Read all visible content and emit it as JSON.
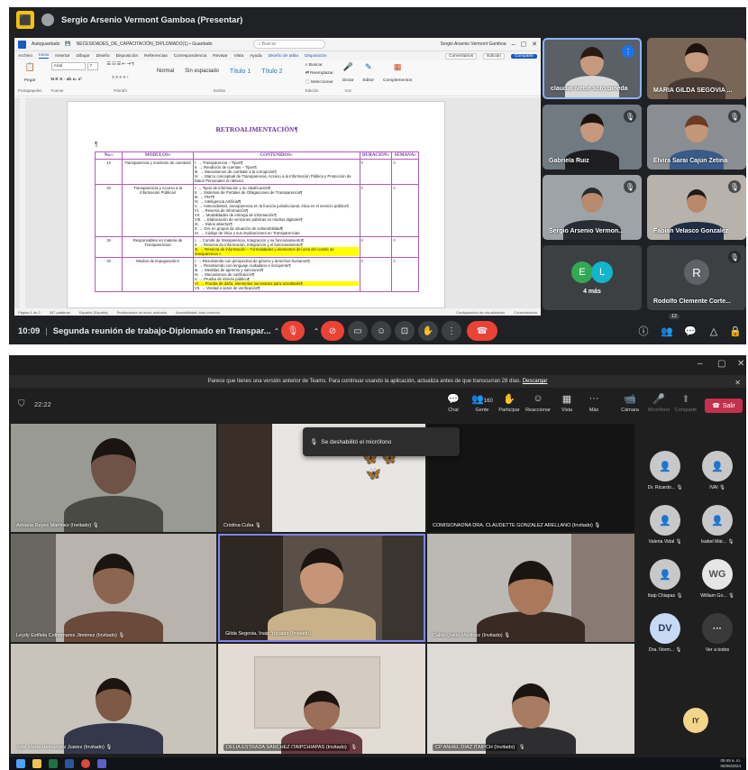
{
  "meet": {
    "presenter_title": "Sergio Arsenio Vermont Gamboa (Presentar)",
    "time": "10:09",
    "separator": "|",
    "meeting_name": "Segunda reunión de trabajo-Diplomado en Transpar...",
    "people_count": "12",
    "participants": [
      {
        "name": "claudia ivette soto pineda"
      },
      {
        "name": "MARIA GILDA SEGOVIA ..."
      },
      {
        "name": "Gabriela Ruiz"
      },
      {
        "name": "Elvira Sarai Cajún Zetina"
      },
      {
        "name": "Sergio Arsenio Vermon..."
      },
      {
        "name": "Fabian Velasco Gonzalez"
      },
      {
        "name": "Rodolfo Clemente Corte..."
      }
    ],
    "more": {
      "label": "4 más",
      "initials": [
        "E",
        "L"
      ]
    },
    "rodolfo_initial": "R",
    "colors": {
      "bg": "#202124",
      "red": "#ea4335",
      "blue": "#1a73e8"
    }
  },
  "word": {
    "autosave": "Autoguardado",
    "filename": "NECESIDADES_DE_CAPACITACIÓN_DIPLOMADO(1) • Guardado",
    "search": "Buscar",
    "user": "Sergio Arsenio Vermont Gamboa",
    "menu": [
      "Archivo",
      "Inicio",
      "Insertar",
      "Dibujar",
      "Diseño",
      "Disposición",
      "Referencias",
      "Correspondencia",
      "Revisar",
      "Vista",
      "Ayuda",
      "Diseño de tabla",
      "Disposición"
    ],
    "menu_right": {
      "comments": "Comentarios",
      "editing": "Edición",
      "share": "Compartir"
    },
    "ribbon": {
      "paste": "Pegar",
      "clipboard": "Portapapeles",
      "font": "Arial",
      "font_size": "7",
      "font_group": "Fuente",
      "paragraph_group": "Párrafo",
      "styles": [
        "Normal",
        "Sin espaciado",
        "Título 1",
        "Título 2"
      ],
      "styles_group": "Estilos",
      "find": "Buscar",
      "replace": "Reemplazar",
      "select": "Seleccionar",
      "edit_group": "Edición",
      "dictate": "Dictar",
      "voice_group": "Voz",
      "editor": "Editor",
      "complements": "Complementos"
    },
    "doc_title": "RETROALIMENTACIÓN¶",
    "table_headers": [
      "No.¤",
      "MÓDULOS¤",
      "CONTENIDOS¤",
      "DURACIÓN¤",
      "SEMANA¤"
    ],
    "rows": [
      {
        "no": "1¤",
        "module": "Transparencia y rendición de cuentas¤",
        "contents": [
          {
            "text": "I. → Transparencia – Tipos¶"
          },
          {
            "text": "II. → Rendición de cuentas – Tipos¶"
          },
          {
            "text": "III. → Mecanismos de combate a la corrupción¶"
          },
          {
            "text": "IV. → Marco conceptual de Transparencia, Acceso a la Información Pública y Protección de Datos Personales en México"
          }
        ]
      },
      {
        "no": "2¤",
        "module": "Transparencia y Acceso a la Información Pública¤",
        "contents": [
          {
            "text": "I. → Tipos de información y su clasificación¶"
          },
          {
            "text": "II. → Sistemas de Portales de Obligaciones de Transparencia¶"
          },
          {
            "text": "III. → PNT¶"
          },
          {
            "text": "IV. → Inteligencia Artificial¶"
          },
          {
            "text": "V. → Antecedentes, transparencia en la función jurisdiccional, ética en el servicio público¶"
          },
          {
            "text": "VI. → Reserva de información¶"
          },
          {
            "text": "VII. → Modalidades de entrega de información¶"
          },
          {
            "text": "VIII. → Elaboración de versiones públicas en medios digitales¶"
          },
          {
            "text": "IX. → Datos abiertos¶"
          },
          {
            "text": "X. → DAI en grupos de situación de vulnerabilidad¶"
          },
          {
            "text": "XI. → Código de ética y sus implicaciones en Transparencian"
          }
        ]
      },
      {
        "no": "3¤",
        "module": "Responsables en materia de Transparencia¤",
        "contents": [
          {
            "text": "I. → Comité de transparencia, Integración y su funcionamiento¶"
          },
          {
            "text": "II. → Reserva de Información, Integración y el funcionamiento¶"
          },
          {
            "text": "III. → Reserva de información – Formalidades y elementos del acta del comité de transparencia »",
            "highlight": true
          }
        ]
      },
      {
        "no": "4¤",
        "module": "Medios de impugnación¤",
        "contents": [
          {
            "text": "I. → Resolviendo con perspectiva de género y derechos humanos¶"
          },
          {
            "text": "II. → Resolviendo con lenguaje ciudadano e incluyente¶"
          },
          {
            "text": "III. → Medidas de apremio y sanciones¶"
          },
          {
            "text": "IV. → Mecanismos de notificación¶"
          },
          {
            "text": "V. → Prueba de interés público¶"
          },
          {
            "text": "VI. → Prueba de daño, elementos necesarios para acreditarla¶",
            "highlight": true
          },
          {
            "text": "VII. → Verdad o actos de verificación¶"
          }
        ]
      }
    ],
    "cell_mark": "¤",
    "pilcrow": "¶",
    "status": [
      "Página 1 de 2",
      "397 palabras",
      "Español (España)",
      "Predicciones de texto: activado",
      "Accesibilidad: todo correcto",
      "Configuración de visualización",
      "Concentración"
    ]
  },
  "teams": {
    "banner": "Parece que tienes una versión anterior de Teams. Para continuar usando la aplicación, actualiza antes de que transcurran 28 días.",
    "banner_link": "Descargar",
    "timer": "22:22",
    "tools": [
      {
        "icon": "💬",
        "label": "Chat"
      },
      {
        "icon": "👥",
        "label": "Gente"
      },
      {
        "icon": "✋",
        "label": "Participar"
      },
      {
        "icon": "☺",
        "label": "Reaccionar"
      },
      {
        "icon": "▦",
        "label": "Vista"
      },
      {
        "icon": "···",
        "label": "Más"
      },
      {
        "icon": "📹",
        "label": "Cámara"
      },
      {
        "icon": "🎤",
        "label": "Micrófono"
      },
      {
        "icon": "⬆",
        "label": "Compartir"
      }
    ],
    "people_count": "160",
    "leave": "Salir",
    "toast": "Se deshabilitó el micrófono",
    "tiles": [
      {
        "name": "Adriana Reyes Martinez (Invitado)"
      },
      {
        "name": "Cristina Cuba"
      },
      {
        "name": "COMISIONADNA DRA. CLAUDETTE GONZALEZ ARELLANO (Invitado)"
      },
      {
        "name": "Leydy Estfiela Colmenares Jiménez (Invitado)"
      },
      {
        "name": "Gilda Segovia, Inaip Yucatán (Invitado)"
      },
      {
        "name": "Dalila Quero Martinez (Invitado)"
      },
      {
        "name": "Jose Maria Hernandez Juarez (Invitado)"
      },
      {
        "name": "DELIA ESTRADA SANCHEZ ITAIPCHIAPAS (Invitado)"
      },
      {
        "name": "CP ANHEL DIAZ ITAIPCH (Invitado)"
      }
    ],
    "side": [
      {
        "name": "Dr. Ricardo...",
        "initials": ""
      },
      {
        "name": "IVAI",
        "initials": ""
      },
      {
        "name": "Valeria Vidal",
        "initials": ""
      },
      {
        "name": "Isabel Már...",
        "initials": ""
      },
      {
        "name": "Itaip Chiapas",
        "initials": ""
      },
      {
        "name": "William Go...",
        "initials": "WG"
      },
      {
        "name": "Dra. Norm...",
        "initials": "DV"
      },
      {
        "name": "Ver a todos",
        "initials": "···"
      }
    ],
    "iy": "IY",
    "clock_time": "09:49 a. m.",
    "clock_date": "06/06/2024",
    "colors": {
      "bg": "#1f1f1f",
      "leave": "#c4314b"
    }
  }
}
